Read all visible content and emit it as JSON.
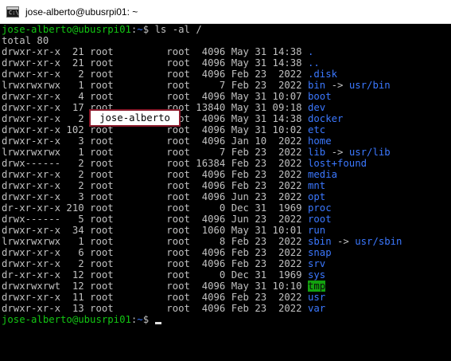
{
  "window": {
    "title": "jose-alberto@ubusrpi01: ~",
    "icon": "terminal-icon",
    "icon_glyph": "C:\\"
  },
  "colors": {
    "background": "#000000",
    "text": "#c0c0c0",
    "prompt_user": "#13c613",
    "prompt_path": "#3b78ff",
    "directory": "#3b78ff",
    "sticky_dir_bg": "#13a10e",
    "highlight_border": "#8b1a2b"
  },
  "terminal": {
    "prompt": {
      "user_host": "jose-alberto@ubusrpi01",
      "sep": ":",
      "path": "~",
      "symbol": "$ "
    },
    "command": "ls -al /",
    "total": "total 80",
    "entries": [
      {
        "meta": "drwxr-xr-x  21 root         root  4096 May 31 14:38 ",
        "name": ".",
        "type": "dir"
      },
      {
        "meta": "drwxr-xr-x  21 root         root  4096 May 31 14:38 ",
        "name": "..",
        "type": "dir"
      },
      {
        "meta": "drwxr-xr-x   2 root         root  4096 Feb 23  2022 ",
        "name": ".disk",
        "type": "dir"
      },
      {
        "meta": "lrwxrwxrwx   1 root         root     7 Feb 23  2022 ",
        "name": "bin",
        "type": "link",
        "target": "usr/bin"
      },
      {
        "meta": "drwxr-xr-x   4 root         root  4096 May 31 10:07 ",
        "name": "boot",
        "type": "dir"
      },
      {
        "meta": "drwxr-xr-x  17 root         root 13840 May 31 09:18 ",
        "name": "dev",
        "type": "dir"
      },
      {
        "meta": "drwxr-xr-x   2 root         root  4096 May 31 14:38 ",
        "name": "docker",
        "type": "dir"
      },
      {
        "meta": "drwxr-xr-x 102 root         root  4096 May 31 10:02 ",
        "name": "etc",
        "type": "dir"
      },
      {
        "meta": "drwxr-xr-x   3 root         root  4096 Jan 10  2022 ",
        "name": "home",
        "type": "dir"
      },
      {
        "meta": "lrwxrwxrwx   1 root         root     7 Feb 23  2022 ",
        "name": "lib",
        "type": "link",
        "target": "usr/lib"
      },
      {
        "meta": "drwx------   2 root         root 16384 Feb 23  2022 ",
        "name": "lost+found",
        "type": "dir"
      },
      {
        "meta": "drwxr-xr-x   2 root         root  4096 Feb 23  2022 ",
        "name": "media",
        "type": "dir"
      },
      {
        "meta": "drwxr-xr-x   2 root         root  4096 Feb 23  2022 ",
        "name": "mnt",
        "type": "dir"
      },
      {
        "meta": "drwxr-xr-x   3 root         root  4096 Jun 23  2022 ",
        "name": "opt",
        "type": "dir"
      },
      {
        "meta": "dr-xr-xr-x 210 root         root     0 Dec 31  1969 ",
        "name": "proc",
        "type": "dir"
      },
      {
        "meta": "drwx------   5 root         root  4096 Jun 23  2022 ",
        "name": "root",
        "type": "dir"
      },
      {
        "meta": "drwxr-xr-x  34 root         root  1060 May 31 10:01 ",
        "name": "run",
        "type": "dir"
      },
      {
        "meta": "lrwxrwxrwx   1 root         root     8 Feb 23  2022 ",
        "name": "sbin",
        "type": "link",
        "target": "usr/sbin"
      },
      {
        "meta": "drwxr-xr-x   6 root         root  4096 Feb 23  2022 ",
        "name": "snap",
        "type": "dir"
      },
      {
        "meta": "drwxr-xr-x   2 root         root  4096 Feb 23  2022 ",
        "name": "srv",
        "type": "dir"
      },
      {
        "meta": "dr-xr-xr-x  12 root         root     0 Dec 31  1969 ",
        "name": "sys",
        "type": "dir"
      },
      {
        "meta": "drwxrwxrwt  12 root         root  4096 May 31 10:10 ",
        "name": "tmp",
        "type": "sticky"
      },
      {
        "meta": "drwxr-xr-x  11 root         root  4096 Feb 23  2022 ",
        "name": "usr",
        "type": "dir"
      },
      {
        "meta": "drwxr-xr-x  13 root         root  4096 Feb 23  2022 ",
        "name": "var",
        "type": "dir"
      }
    ],
    "link_arrow": " -> ",
    "highlight_label": "jose-alberto"
  }
}
